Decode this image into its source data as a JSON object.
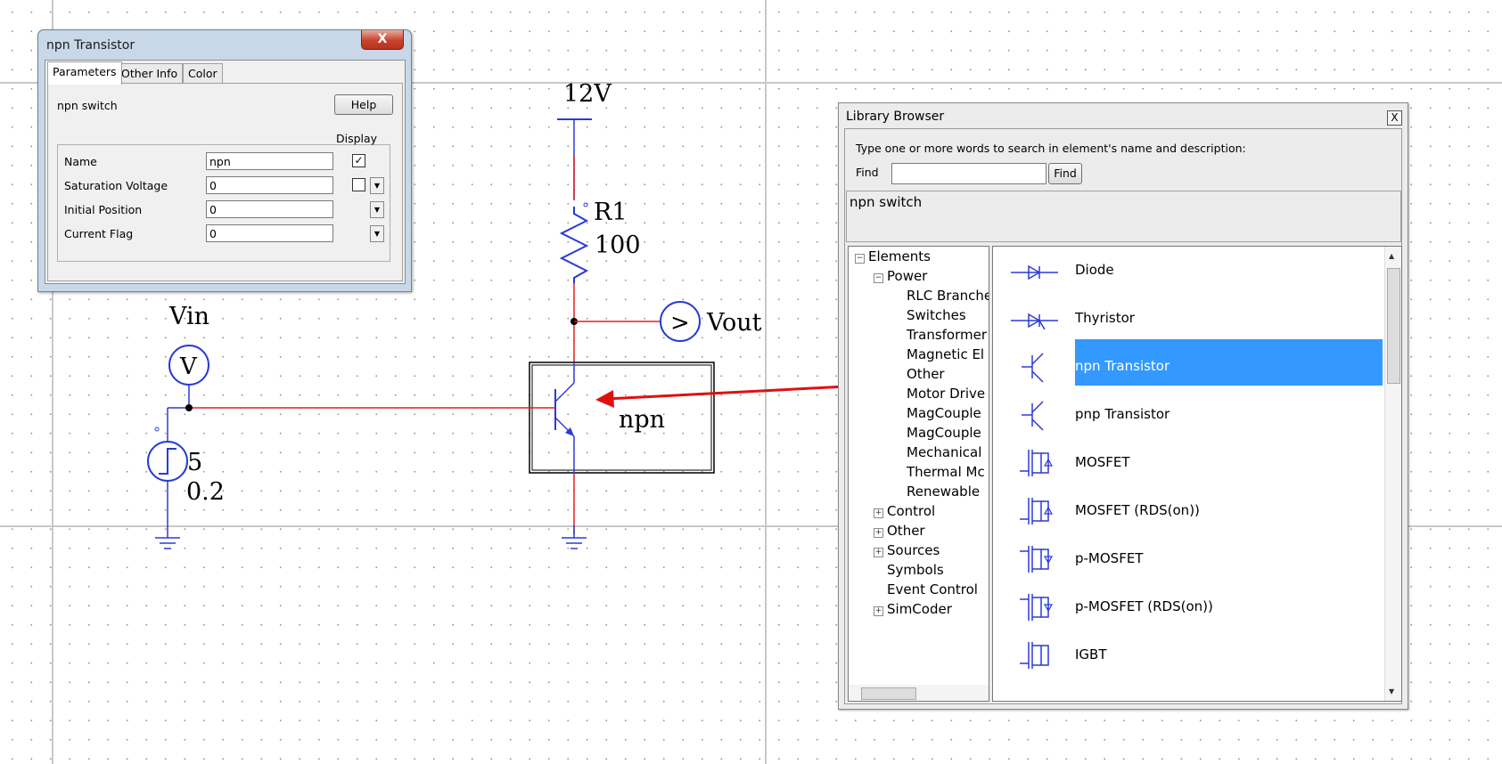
{
  "schematic": {
    "supply_label": "12V",
    "resistor_name": "R1",
    "resistor_value": "100",
    "vout_label": "Vout",
    "vin_label": "Vin",
    "vmeter_symbol": "V",
    "vout_symbol": ">",
    "source_amplitude": "5",
    "source_period": "0.2",
    "transistor_label": "npn"
  },
  "npn_dialog": {
    "title": "npn Transistor",
    "close_label": "X",
    "tabs": [
      "Parameters",
      "Other Info",
      "Color"
    ],
    "description": "npn switch",
    "help_label": "Help",
    "display_header": "Display",
    "params": [
      {
        "name": "Name",
        "value": "npn"
      },
      {
        "name": "Saturation Voltage",
        "value": "0"
      },
      {
        "name": "Initial Position",
        "value": "0"
      },
      {
        "name": "Current Flag",
        "value": "0"
      }
    ]
  },
  "library": {
    "title": "Library Browser",
    "close_label": "X",
    "search_hint": "Type one or more words to search in element's name and  description:",
    "find_label": "Find",
    "find_button": "Find",
    "description": "npn switch",
    "tree": {
      "root": "Elements",
      "power": "Power",
      "power_children": [
        "RLC Branche",
        "Switches",
        "Transformer",
        "Magnetic El",
        "Other",
        "Motor Drive",
        "MagCouple",
        "MagCouple",
        "Mechanical",
        "Thermal Mc",
        "Renewable"
      ],
      "control": "Control",
      "other": "Other",
      "sources": "Sources",
      "symbols": "Symbols",
      "event_control": "Event Control",
      "simcoder": "SimCoder"
    },
    "items": [
      "Diode",
      "Thyristor",
      "npn Transistor",
      "pnp Transistor",
      "MOSFET",
      "MOSFET (RDS(on))",
      "p-MOSFET",
      "p-MOSFET (RDS(on))",
      "IGBT"
    ],
    "selected_item": "npn Transistor"
  },
  "colors": {
    "wire_blue": "#2a3ad6",
    "wire_red": "#e02020",
    "selection": "#3399ff",
    "arrow": "#e01010"
  }
}
